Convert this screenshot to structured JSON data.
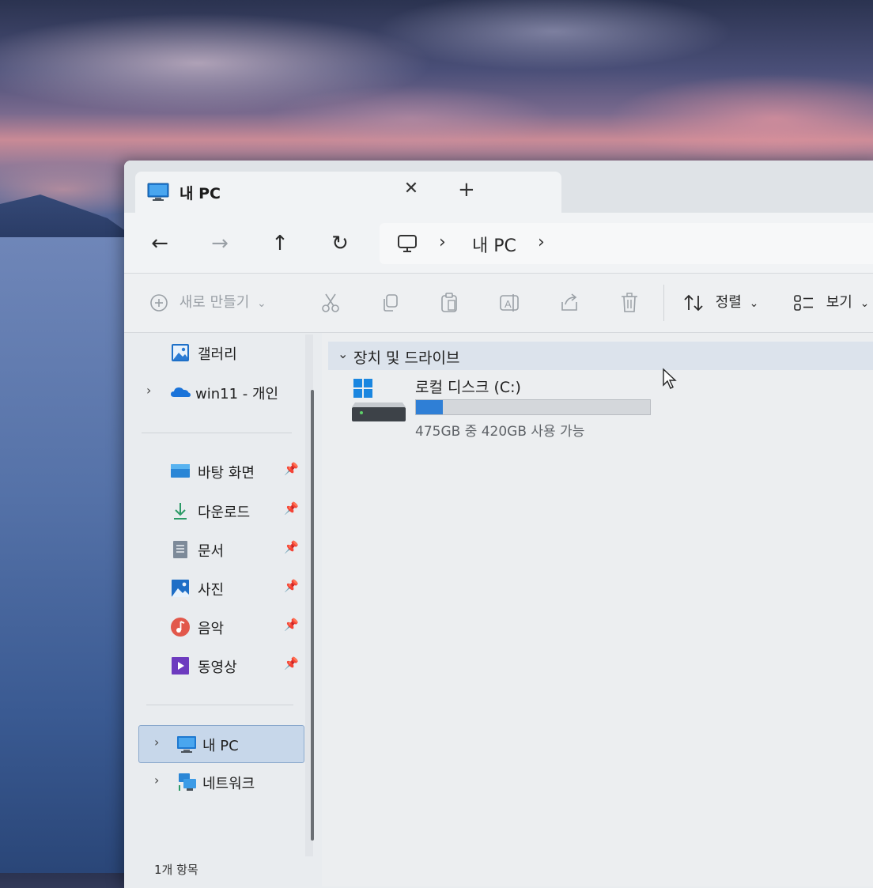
{
  "window": {
    "tab_title": "내 PC",
    "close_glyph": "✕",
    "new_tab_glyph": "+"
  },
  "nav": {
    "back_icon": "←",
    "forward_icon": "→",
    "up_icon": "↑",
    "refresh_icon": "↻",
    "breadcrumb": [
      "내 PC"
    ],
    "sep": "›"
  },
  "toolbar": {
    "new_label": "새로 만들기",
    "sort_label": "정렬",
    "view_label": "보기",
    "dropdown_glyph": "⌄"
  },
  "sidebar": {
    "top": [
      {
        "label": "갤러리",
        "icon": "gallery-icon"
      },
      {
        "label": "win11 - 개인",
        "icon": "onedrive-icon"
      }
    ],
    "quick": [
      {
        "label": "바탕 화면",
        "icon": "desktop-icon"
      },
      {
        "label": "다운로드",
        "icon": "download-icon"
      },
      {
        "label": "문서",
        "icon": "documents-icon"
      },
      {
        "label": "사진",
        "icon": "pictures-icon"
      },
      {
        "label": "음악",
        "icon": "music-icon"
      },
      {
        "label": "동영상",
        "icon": "videos-icon"
      }
    ],
    "bottom": [
      {
        "label": "내 PC",
        "icon": "pc-icon"
      },
      {
        "label": "네트워크",
        "icon": "network-icon"
      }
    ],
    "chevron": "›",
    "pin_glyph": "📌"
  },
  "content": {
    "group_title": "장치 및 드라이브",
    "group_chevron": "⌄",
    "drive": {
      "name": "로컬 디스크 (C:)",
      "usage": "475GB 중 420GB 사용 가능",
      "used_fraction": 0.116
    }
  },
  "status": {
    "item_count": "1개 항목"
  },
  "colors": {
    "accent": "#2f7fd6",
    "selection": "#c7d7ea"
  }
}
